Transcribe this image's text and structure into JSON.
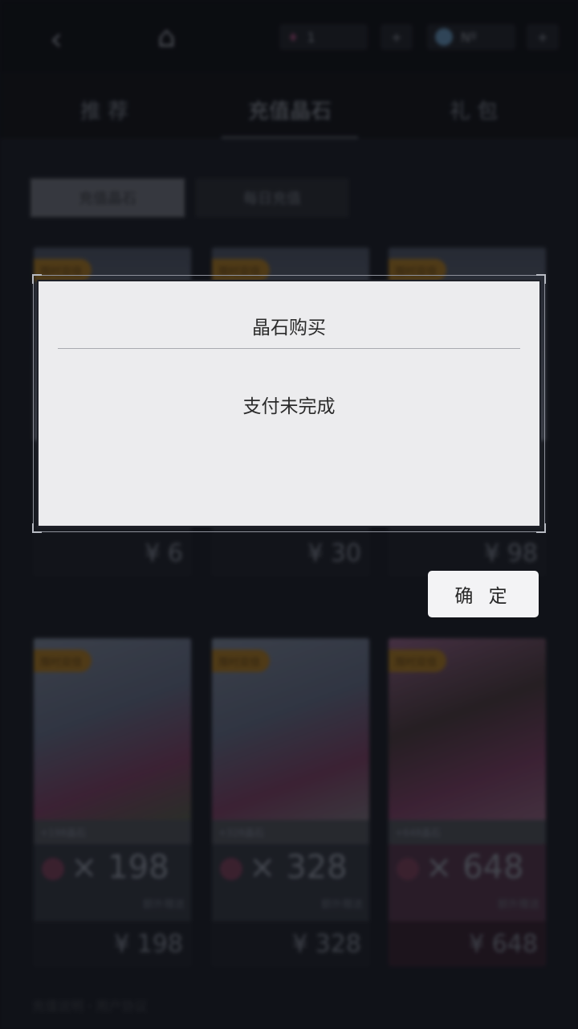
{
  "topbar": {
    "back_icon": "‹",
    "home_icon": "⌂",
    "gem_count": "1",
    "currency2_value": "Nº"
  },
  "tabs": [
    {
      "label": "推 荐"
    },
    {
      "label": "充值晶石"
    },
    {
      "label": "礼 包"
    }
  ],
  "subtabs": {
    "left": "充值晶石",
    "right": "每日充值"
  },
  "cards_row1": [
    {
      "badge": "限时双倍",
      "price": "¥ 6"
    },
    {
      "badge": "限时双倍",
      "price": "¥ 30"
    },
    {
      "badge": "限时双倍",
      "price": "¥ 98"
    }
  ],
  "cards_row2": [
    {
      "badge": "限时双倍",
      "strip": "+198晶石",
      "amount": "× 198",
      "bonus": "额外赠送",
      "price": "¥ 198"
    },
    {
      "badge": "限时双倍",
      "strip": "+328晶石",
      "amount": "× 328",
      "bonus": "额外赠送",
      "price": "¥ 328"
    },
    {
      "badge": "限时双倍",
      "strip": "+648晶石",
      "amount": "× 648",
      "bonus": "额外赠送",
      "price": "¥ 648"
    }
  ],
  "footer_note": "充值说明 · 用户协议",
  "dialog": {
    "title": "晶石购买",
    "message": "支付未完成",
    "confirm_label": "确 定"
  },
  "colors": {
    "dialog_bg": "#ececee",
    "page_bg": "#141720",
    "badge": "#7a5a24"
  }
}
